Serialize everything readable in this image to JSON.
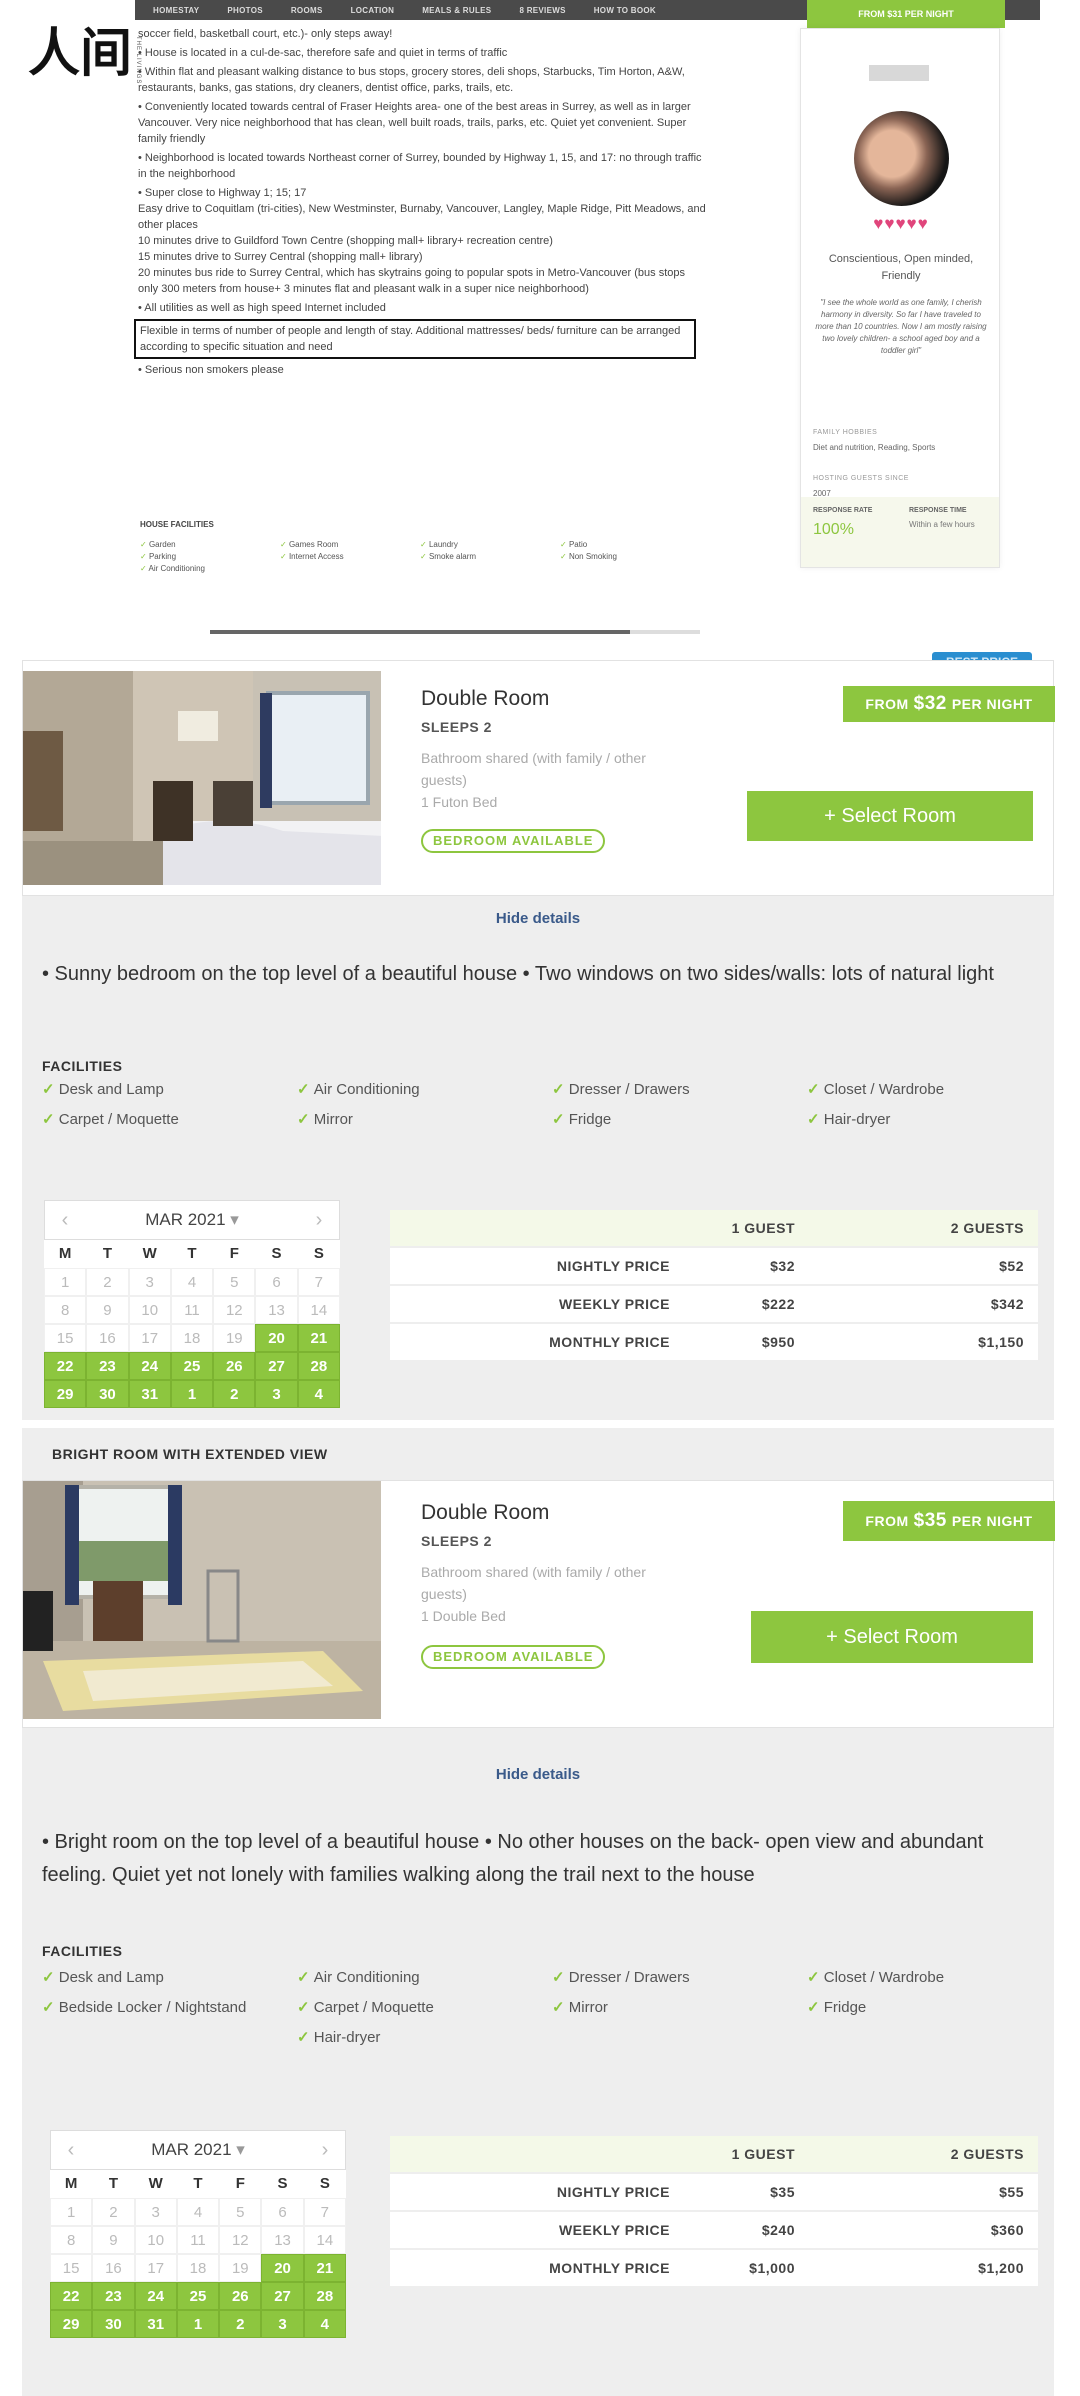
{
  "nav": {
    "items": [
      "HOMESTAY",
      "PHOTOS",
      "ROOMS",
      "LOCATION",
      "MEALS & RULES",
      "8 REVIEWS",
      "HOW TO BOOK"
    ],
    "cta": "FROM $31 PER NIGHT"
  },
  "watermark": {
    "logo": "人间",
    "sub": "THE LIVINGS"
  },
  "description": {
    "lines": [
      "soccer field, basketball court, etc.)- only steps away!",
      "• House is located in a cul-de-sac, therefore safe and quiet in terms of traffic",
      "• Within flat and pleasant walking distance to bus stops, grocery stores, deli shops, Starbucks, Tim Horton, A&W, restaurants, banks, gas stations, dry cleaners, dentist office, parks, trails, etc.",
      "• Conveniently located towards central of Fraser Heights area- one of the best areas in Surrey, as well as in larger Vancouver. Very nice neighborhood that has clean, well built roads, trails, parks, etc. Quiet yet convenient. Super family friendly",
      "• Neighborhood is located towards Northeast corner of Surrey, bounded by Highway 1, 15, and 17: no through traffic in the neighborhood",
      "• Super close to Highway 1; 15; 17\nEasy drive to Coquitlam (tri-cities), New Westminster, Burnaby, Vancouver, Langley, Maple Ridge, Pitt Meadows, and other places\n10 minutes drive to Guildford Town Centre (shopping mall+ library+ recreation centre)\n15 minutes drive to Surrey Central (shopping mall+ library)\n20 minutes bus ride to Surrey Central, which has skytrains going to popular spots in Metro-Vancouver (bus stops only 300 meters from house+ 3 minutes flat and pleasant walk in a super nice neighborhood)",
      "• All utilities as well as high speed Internet included"
    ],
    "highlight": "Flexible in terms of number of people and length of stay. Additional mattresses/ beds/ furniture can be arranged according to specific situation and need",
    "after": "• Serious non smokers please",
    "facilities_label": "HOUSE FACILITIES",
    "facilities": [
      "Garden",
      "Games Room",
      "Laundry",
      "Patio",
      "Parking",
      "Internet Access",
      "Smoke alarm",
      "Non Smoking",
      "Air Conditioning"
    ]
  },
  "host": {
    "traits": "Conscientious, Open minded, Friendly",
    "quote": "\"I see the whole world as one family, I cherish harmony in diversity. So far I have traveled to more than 10 countries. Now I am mostly raising two lovely children- a school aged boy and a toddler girl\"",
    "hobbies_label": "FAMILY HOBBIES",
    "hobbies": "Diet and nutrition, Reading, Sports",
    "since_label": "HOSTING GUESTS SINCE",
    "since": "2007",
    "rate_label": "RESPONSE RATE",
    "rate": "100%",
    "time_label": "RESPONSE TIME",
    "time": "Within a few hours"
  },
  "rooms": [
    {
      "section_label": "",
      "best_price": "BEST PRICE",
      "title": "Double Room",
      "sleeps": "SLEEPS 2",
      "bathroom": "Bathroom shared (with family / other guests)",
      "bed": "1 Futon Bed",
      "badge": "BEDROOM AVAILABLE",
      "price_from": "FROM",
      "price": "$32",
      "price_per": "PER NIGHT",
      "select": "+ Select Room",
      "hide": "Hide details",
      "desc": "• Sunny bedroom on the top level of a beautiful house • Two windows on two sides/walls: lots of natural light",
      "facilities_label": "FACILITIES",
      "facilities": [
        "Desk and Lamp",
        "Air Conditioning",
        "Dresser / Drawers",
        "Closet / Wardrobe",
        "Carpet / Moquette",
        "Mirror",
        "Fridge",
        "Hair-dryer"
      ],
      "calendar": {
        "month": "MAR 2021"
      },
      "price_table": {
        "headers": [
          "",
          "1 GUEST",
          "2 GUESTS"
        ],
        "rows": [
          [
            "NIGHTLY PRICE",
            "$32",
            "$52"
          ],
          [
            "WEEKLY PRICE",
            "$222",
            "$342"
          ],
          [
            "MONTHLY PRICE",
            "$950",
            "$1,150"
          ]
        ]
      }
    },
    {
      "section_label": "BRIGHT ROOM WITH EXTENDED VIEW",
      "best_price": "",
      "title": "Double Room",
      "sleeps": "SLEEPS 2",
      "bathroom": "Bathroom shared (with family / other guests)",
      "bed": "1 Double Bed",
      "badge": "BEDROOM AVAILABLE",
      "price_from": "FROM",
      "price": "$35",
      "price_per": "PER NIGHT",
      "select": "+ Select Room",
      "hide": "Hide details",
      "desc": "• Bright room on the top level of a beautiful house • No other houses on the back- open view and abundant feeling. Quiet yet not lonely with families walking along the trail next to the house",
      "facilities_label": "FACILITIES",
      "facilities": [
        "Desk and Lamp",
        "Air Conditioning",
        "Dresser / Drawers",
        "Closet / Wardrobe",
        "Bedside Locker / Nightstand",
        "Carpet / Moquette",
        "Mirror",
        "Fridge",
        "",
        "Hair-dryer"
      ],
      "calendar": {
        "month": "MAR 2021"
      },
      "price_table": {
        "headers": [
          "",
          "1 GUEST",
          "2 GUESTS"
        ],
        "rows": [
          [
            "NIGHTLY PRICE",
            "$35",
            "$55"
          ],
          [
            "WEEKLY PRICE",
            "$240",
            "$360"
          ],
          [
            "MONTHLY PRICE",
            "$1,000",
            "$1,200"
          ]
        ]
      }
    }
  ],
  "calendar_common": {
    "dow": [
      "M",
      "T",
      "W",
      "T",
      "F",
      "S",
      "S"
    ],
    "days": [
      "1",
      "2",
      "3",
      "4",
      "5",
      "6",
      "7",
      "8",
      "9",
      "10",
      "11",
      "12",
      "13",
      "14",
      "15",
      "16",
      "17",
      "18",
      "19",
      "20",
      "21",
      "22",
      "23",
      "24",
      "25",
      "26",
      "27",
      "28",
      "29",
      "30",
      "31",
      "1",
      "2",
      "3",
      "4"
    ],
    "available_from_index": 19
  },
  "colors": {
    "accent": "#8dc63f",
    "link": "#3a5a8a",
    "heart": "#e0457b",
    "nav": "#4a4a4a"
  }
}
